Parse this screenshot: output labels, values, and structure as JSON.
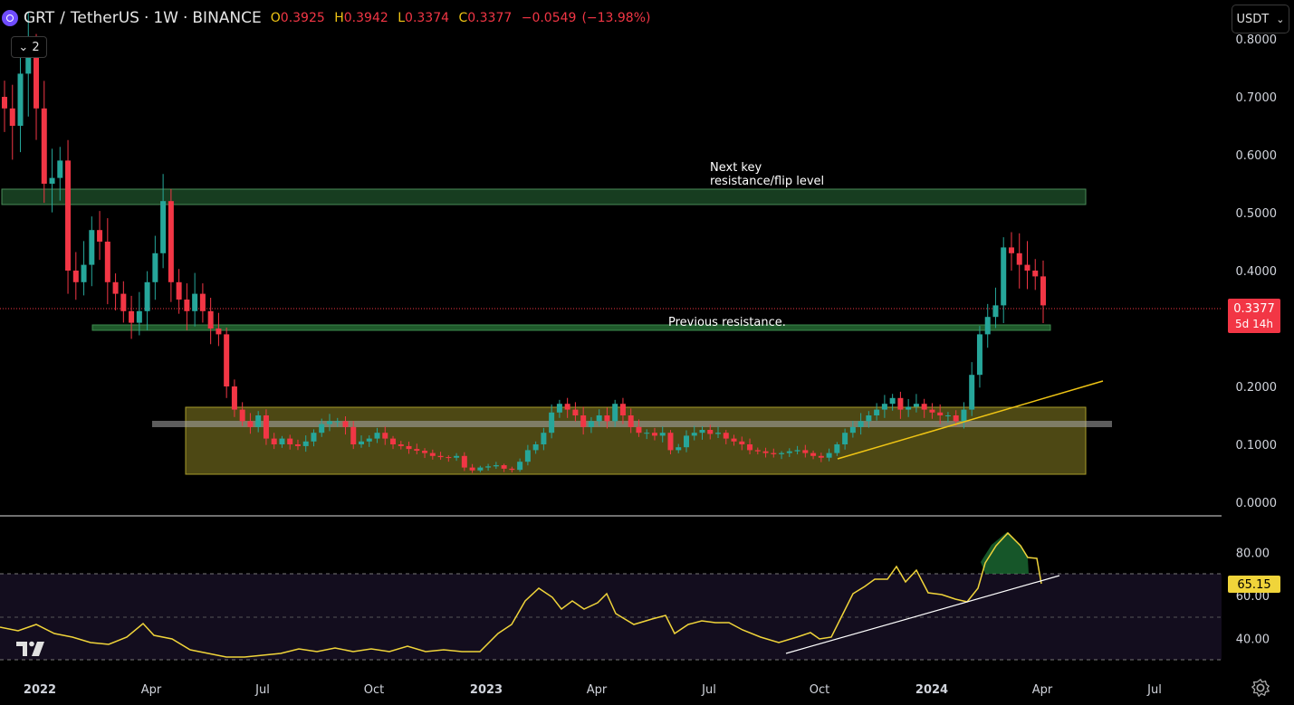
{
  "header": {
    "symbol": "GRT",
    "separator": "/",
    "quote": "TetherUS",
    "interval": "1W",
    "exchange": "BINANCE",
    "dot": "·",
    "o_label": "O",
    "o_value": "0.3925",
    "h_label": "H",
    "h_value": "0.3942",
    "l_label": "L",
    "l_value": "0.3374",
    "c_label": "C",
    "c_value": "0.3377",
    "change": "−0.0549",
    "change_pct": "(−13.98%)"
  },
  "indicator_toggle": {
    "count": "2"
  },
  "currency_selector": {
    "label": "USDT"
  },
  "price_axis": [
    "0.8000",
    "0.7000",
    "0.6000",
    "0.5000",
    "0.4000",
    "0.2000",
    "0.1000",
    "0.0000"
  ],
  "current_price": {
    "price": "0.3377",
    "countdown": "5d 14h"
  },
  "rsi_axis": [
    "80.00",
    "60.00",
    "40.00"
  ],
  "rsi_current": "65.15",
  "time_axis": [
    "2022",
    "Apr",
    "Jul",
    "Oct",
    "2023",
    "Apr",
    "Jul",
    "Oct",
    "2024",
    "Apr",
    "Jul"
  ],
  "annotations": {
    "next_key_1": "Next key",
    "next_key_2": "resistance/flip level",
    "previous_resistance": "Previous resistance."
  },
  "colors": {
    "up": "#26a69a",
    "down": "#f23645",
    "rsi_line": "#f0d43a",
    "accent_yellow": "#f0c514",
    "zone_green": "#1e4d27",
    "zone_olive": "#5a5518"
  },
  "chart_data": {
    "type": "candlestick",
    "symbol": "GRT/USDT",
    "interval": "1W",
    "y_range": [
      0,
      0.8
    ],
    "closes": [
      0.68,
      0.65,
      0.74,
      0.77,
      0.68,
      0.55,
      0.56,
      0.59,
      0.4,
      0.38,
      0.41,
      0.47,
      0.45,
      0.38,
      0.36,
      0.33,
      0.31,
      0.33,
      0.38,
      0.43,
      0.52,
      0.38,
      0.35,
      0.33,
      0.36,
      0.33,
      0.3,
      0.29,
      0.2,
      0.16,
      0.14,
      0.13,
      0.15,
      0.11,
      0.1,
      0.11,
      0.1,
      0.097,
      0.105,
      0.12,
      0.135,
      0.14,
      0.14,
      0.13,
      0.1,
      0.105,
      0.11,
      0.12,
      0.11,
      0.1,
      0.097,
      0.092,
      0.089,
      0.085,
      0.08,
      0.078,
      0.077,
      0.08,
      0.06,
      0.055,
      0.06,
      0.062,
      0.064,
      0.058,
      0.056,
      0.07,
      0.09,
      0.1,
      0.12,
      0.155,
      0.17,
      0.16,
      0.15,
      0.13,
      0.14,
      0.15,
      0.14,
      0.17,
      0.15,
      0.13,
      0.12,
      0.12,
      0.115,
      0.12,
      0.09,
      0.095,
      0.115,
      0.12,
      0.125,
      0.118,
      0.12,
      0.11,
      0.105,
      0.1,
      0.09,
      0.088,
      0.085,
      0.083,
      0.085,
      0.088,
      0.09,
      0.085,
      0.08,
      0.077,
      0.085,
      0.1,
      0.12,
      0.13,
      0.14,
      0.15,
      0.16,
      0.17,
      0.18,
      0.16,
      0.165,
      0.17,
      0.16,
      0.155,
      0.15,
      0.15,
      0.14,
      0.16,
      0.22,
      0.29,
      0.32,
      0.34,
      0.44,
      0.43,
      0.41,
      0.4,
      0.39,
      0.34
    ],
    "series": [
      {
        "name": "RSI",
        "current": 65.15,
        "y_range": [
          20,
          90
        ]
      }
    ],
    "zones": [
      {
        "label": "Next key resistance/flip level",
        "from": 0.515,
        "to": 0.54
      },
      {
        "label": "Previous resistance.",
        "from": 0.295,
        "to": 0.303
      },
      {
        "label": "",
        "from": 0.05,
        "to": 0.165
      }
    ]
  }
}
